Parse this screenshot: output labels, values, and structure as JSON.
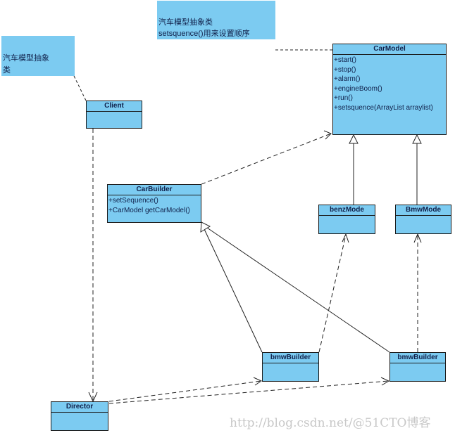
{
  "diagram_type": "UML class diagram",
  "notes": [
    {
      "id": "note-top",
      "lines": [
        "汽车模型抽象类",
        "setsquence()用来设置顺序"
      ]
    },
    {
      "id": "note-left",
      "lines": [
        "汽车模型抽象",
        "类"
      ]
    }
  ],
  "classes": {
    "carmodel": {
      "name": "CarModel",
      "operations": [
        "+start()",
        "+stop()",
        "+alarm()",
        "+engineBoom()",
        "+run()",
        "+setsquence(ArrayList arraylist)"
      ]
    },
    "client": {
      "name": "Client",
      "operations": []
    },
    "carbuilder": {
      "name": "CarBuilder",
      "operations": [
        "+setSequence()",
        "+CarModel getCarModel()"
      ]
    },
    "benzmode": {
      "name": "benzMode",
      "operations": []
    },
    "bmwmode": {
      "name": "BmwMode",
      "operations": []
    },
    "bmwbuilder1": {
      "name": "bmwBuilder",
      "operations": []
    },
    "bmwbuilder2": {
      "name": "bmwBuilder",
      "operations": []
    },
    "director": {
      "name": "Director",
      "operations": []
    }
  },
  "relationships": [
    {
      "type": "note-link",
      "from": "note-top",
      "to": "CarModel"
    },
    {
      "type": "note-link",
      "from": "note-left",
      "to": "Client"
    },
    {
      "type": "dependency",
      "from": "CarBuilder",
      "to": "CarModel"
    },
    {
      "type": "generalization",
      "from": "benzMode",
      "to": "CarModel"
    },
    {
      "type": "generalization",
      "from": "BmwMode",
      "to": "CarModel"
    },
    {
      "type": "generalization",
      "from": "bmwBuilder",
      "to": "CarBuilder"
    },
    {
      "type": "generalization",
      "from": "bmwBuilder (2)",
      "to": "CarBuilder"
    },
    {
      "type": "dependency",
      "from": "bmwBuilder",
      "to": "benzMode"
    },
    {
      "type": "dependency",
      "from": "bmwBuilder (2)",
      "to": "BmwMode"
    },
    {
      "type": "dependency",
      "from": "Client",
      "to": "Director"
    },
    {
      "type": "dependency",
      "from": "Director",
      "to": "bmwBuilder"
    },
    {
      "type": "dependency",
      "from": "Director",
      "to": "bmwBuilder (2)"
    }
  ],
  "watermark": "http://blog.csdn.net/@51CTO博客",
  "colors": {
    "class_fill": "#7ccbf1",
    "border": "#1a1a1a",
    "text": "#10204a"
  }
}
